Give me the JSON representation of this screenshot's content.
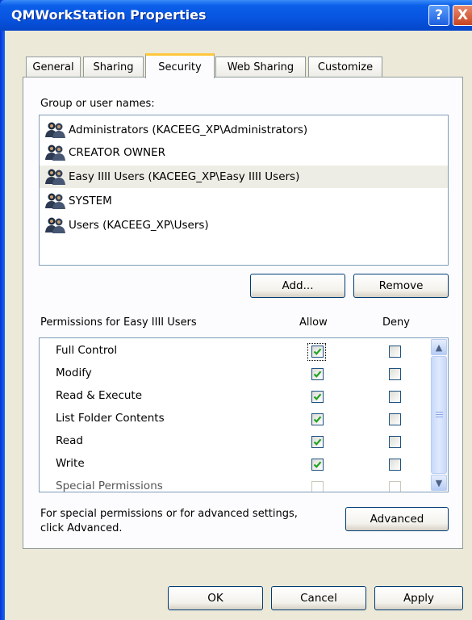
{
  "window": {
    "title": "QMWorkStation Properties",
    "help_label": "?",
    "close_label": "X"
  },
  "tabs": [
    {
      "label": "General"
    },
    {
      "label": "Sharing"
    },
    {
      "label": "Security"
    },
    {
      "label": "Web Sharing"
    },
    {
      "label": "Customize"
    }
  ],
  "groups": {
    "label": "Group or user names:",
    "items": [
      {
        "name": "Administrators (KACEEG_XP\\Administrators)"
      },
      {
        "name": "CREATOR OWNER"
      },
      {
        "name": "Easy IIII Users (KACEEG_XP\\Easy IIII Users)"
      },
      {
        "name": "SYSTEM"
      },
      {
        "name": "Users (KACEEG_XP\\Users)"
      }
    ],
    "add_label": "Add...",
    "remove_label": "Remove"
  },
  "permissions": {
    "label": "Permissions for Easy IIII Users",
    "allow_header": "Allow",
    "deny_header": "Deny",
    "rows": [
      {
        "name": "Full Control",
        "allow": true,
        "deny": false
      },
      {
        "name": "Modify",
        "allow": true,
        "deny": false
      },
      {
        "name": "Read & Execute",
        "allow": true,
        "deny": false
      },
      {
        "name": "List Folder Contents",
        "allow": true,
        "deny": false
      },
      {
        "name": "Read",
        "allow": true,
        "deny": false
      },
      {
        "name": "Write",
        "allow": true,
        "deny": false
      },
      {
        "name": "Special Permissions",
        "allow": false,
        "deny": false
      }
    ]
  },
  "advanced": {
    "text_line1": "For special permissions or for advanced settings,",
    "text_line2": "click Advanced.",
    "button_label": "Advanced"
  },
  "footer": {
    "ok_label": "OK",
    "cancel_label": "Cancel",
    "apply_label": "Apply"
  },
  "colors": {
    "title_bar": "#0854e0",
    "face": "#ece9d8",
    "selection": "#eeede5",
    "check": "#21a121"
  }
}
